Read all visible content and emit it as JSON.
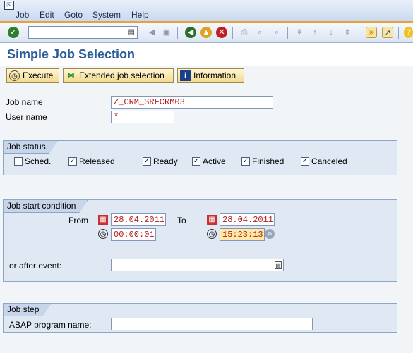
{
  "menubar": {
    "items": [
      "Job",
      "Edit",
      "Goto",
      "System",
      "Help"
    ]
  },
  "toolbar": {
    "command_value": "",
    "icons": [
      "enter-icon",
      "save-icon",
      "back-icon",
      "exit-icon",
      "cancel-icon",
      "print-icon",
      "find-icon",
      "find-next-icon",
      "first-page-icon",
      "previous-page-icon",
      "next-page-icon",
      "last-page-icon",
      "create-session-icon",
      "shortcut-icon",
      "help-icon"
    ]
  },
  "page": {
    "title": "Simple Job Selection"
  },
  "app_toolbar": {
    "execute": "Execute",
    "extended": "Extended job selection",
    "information": "Information"
  },
  "form": {
    "job_name_label": "Job name",
    "job_name_value": "Z_CRM_SRFCRM03",
    "user_name_label": "User name",
    "user_name_value": "*"
  },
  "job_status": {
    "title": "Job status",
    "options": [
      {
        "label": "Sched.",
        "checked": false
      },
      {
        "label": "Released",
        "checked": true
      },
      {
        "label": "Ready",
        "checked": true
      },
      {
        "label": "Active",
        "checked": true
      },
      {
        "label": "Finished",
        "checked": true
      },
      {
        "label": "Canceled",
        "checked": true
      }
    ]
  },
  "start_condition": {
    "title": "Job start condition",
    "from_label": "From",
    "to_label": "To",
    "from_date": "28.04.2011",
    "from_time": "00:00:01",
    "to_date": "28.04.2011",
    "to_time": "15:23:13",
    "event_label": "or after event:",
    "event_value": ""
  },
  "job_step": {
    "title": "Job step",
    "abap_label": "ABAP program name:",
    "abap_value": ""
  },
  "colors": {
    "title": "#2a5c9a",
    "accent_line": "#e8a23c",
    "field_text": "#b31b1b",
    "highlight_field": "#ffe9a8"
  }
}
